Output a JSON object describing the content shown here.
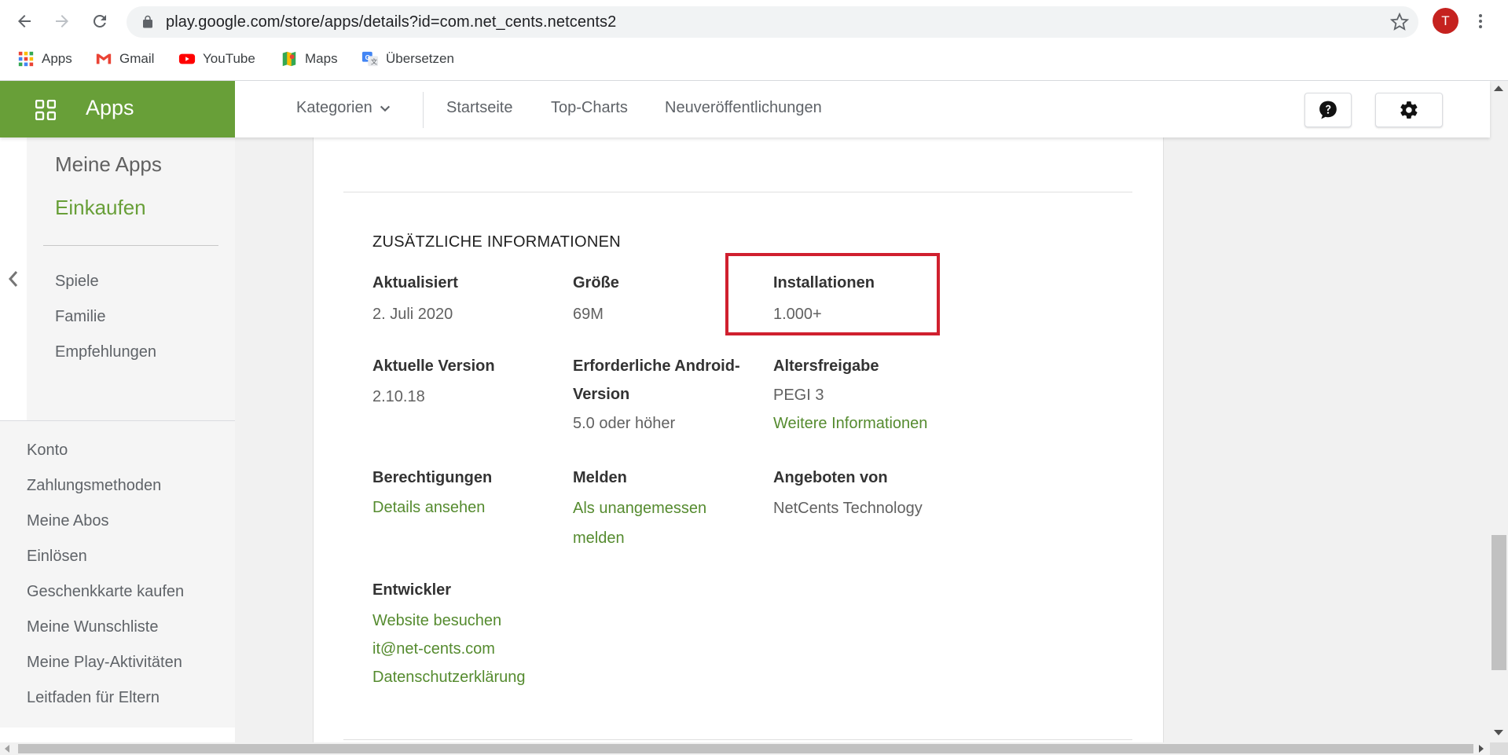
{
  "browser": {
    "url": "play.google.com/store/apps/details?id=com.net_cents.netcents2",
    "profile_initial": "T",
    "bookmarks": [
      {
        "label": "Apps",
        "icon": "apps-grid-icon"
      },
      {
        "label": "Gmail",
        "icon": "gmail-icon"
      },
      {
        "label": "YouTube",
        "icon": "youtube-icon"
      },
      {
        "label": "Maps",
        "icon": "maps-icon"
      },
      {
        "label": "Übersetzen",
        "icon": "translate-icon"
      }
    ]
  },
  "header": {
    "apps_title": "Apps",
    "categories_label": "Kategorien",
    "nav": [
      "Startseite",
      "Top-Charts",
      "Neuveröffentlichungen"
    ]
  },
  "sidebar": {
    "top_items": [
      {
        "label": "Meine Apps",
        "active": false
      },
      {
        "label": "Einkaufen",
        "active": true
      }
    ],
    "category_items": [
      "Spiele",
      "Familie",
      "Empfehlungen"
    ],
    "account_items": [
      "Konto",
      "Zahlungsmethoden",
      "Meine Abos",
      "Einlösen",
      "Geschenkkarte kaufen",
      "Meine Wunschliste",
      "Meine Play-Aktivitäten",
      "Leitfaden für Eltern"
    ]
  },
  "info": {
    "section_title": "ZUSÄTZLICHE INFORMATIONEN",
    "updated": {
      "label": "Aktualisiert",
      "value": "2. Juli 2020"
    },
    "size": {
      "label": "Größe",
      "value": "69M"
    },
    "installs": {
      "label": "Installationen",
      "value": "1.000+"
    },
    "current_version": {
      "label": "Aktuelle Version",
      "value": "2.10.18"
    },
    "android_version": {
      "label_line1": "Erforderliche Android-",
      "label_line2": "Version",
      "value": "5.0 oder höher"
    },
    "rating": {
      "label": "Altersfreigabe",
      "value": "PEGI 3",
      "link": "Weitere Informationen"
    },
    "permissions": {
      "label": "Berechtigungen",
      "link": "Details ansehen"
    },
    "report": {
      "label": "Melden",
      "link_line1": "Als unangemessen",
      "link_line2": "melden"
    },
    "offered_by": {
      "label": "Angeboten von",
      "value": "NetCents Technology"
    },
    "developer": {
      "label": "Entwickler",
      "links": [
        "Website besuchen",
        "it@net-cents.com",
        "Datenschutzerklärung"
      ]
    }
  },
  "colors": {
    "play_green": "#689f38",
    "link_green": "#558b2f",
    "highlight_red": "#d0202f",
    "avatar_red": "#c5221f"
  }
}
